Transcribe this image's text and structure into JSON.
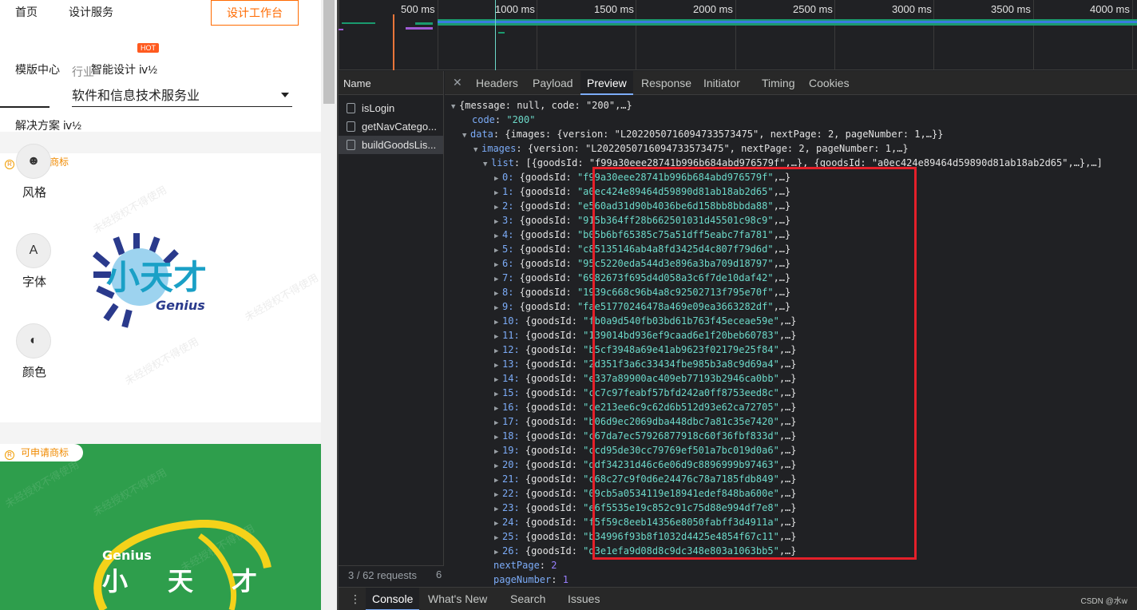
{
  "site": {
    "nav": {
      "home": "首页",
      "design_service": "设计服务",
      "workspace_button": "设计工作台"
    },
    "filters": {
      "template_center": "模版中心",
      "industry_label": "行业",
      "ai_design": "智能设计 ⅳ½",
      "hot": "HOT",
      "industry_value": "软件和信息技术服务业",
      "solutions": "解决方案 ⅳ½"
    },
    "badge": "可申请商标",
    "tools": [
      {
        "label": "风格",
        "glyph": "☻"
      },
      {
        "label": "字体",
        "glyph": "A"
      },
      {
        "label": "颜色",
        "glyph": "◐"
      }
    ],
    "logo1": {
      "cn": "小天才",
      "en": "Genius"
    },
    "logo2": {
      "en": "Genius",
      "chars": [
        "小",
        "天",
        "才"
      ]
    },
    "watermark": "未经授权不得使用"
  },
  "devtools": {
    "timeline_ticks": [
      "500 ms",
      "1000 ms",
      "1500 ms",
      "2000 ms",
      "2500 ms",
      "3000 ms",
      "3500 ms",
      "4000 ms"
    ],
    "name_header": "Name",
    "requests": [
      "isLogin",
      "getNavCatego...",
      "buildGoodsLis..."
    ],
    "request_count": "3 / 62 requests",
    "request_count_trail": "6",
    "tabs": [
      "Headers",
      "Payload",
      "Preview",
      "Response",
      "Initiator",
      "Timing",
      "Cookies"
    ],
    "active_tab": "Preview",
    "preview": {
      "root": "{message: null, code: \"200\",…}",
      "code_key": "code",
      "code_val": "\"200\"",
      "data_key": "data",
      "data_val": "{images: {version: \"L2022050716094733573475\", nextPage: 2, pageNumber: 1,…}}",
      "images_key": "images",
      "images_val": "{version: \"L2022050716094733573475\", nextPage: 2, pageNumber: 1,…}",
      "list_key": "list",
      "list_val": "[{goodsId: \"f99a30eee28741b996b684abd976579f\",…}, {goodsId: \"a0ec424e89464d59890d81ab18ab2d65\",…},…]",
      "items": [
        "f99a30eee28741b996b684abd976579f",
        "a0ec424e89464d59890d81ab18ab2d65",
        "e560ad31d90b4036be6d158bb8bbda88",
        "915b364ff28b662501031d45501c98c9",
        "b05b6bf65385c75a51dff5eabc7fa781",
        "c85135146ab4a8fd3425d4c807f79d6d",
        "95c5220eda544d3e896a3ba709d18797",
        "6982673f695d4d058a3c6f7de10daf42",
        "1939c668c96b4a8c92502713f795e70f",
        "fae51770246478a469e09ea3663282df",
        "fb0a9d540fb03bd61b763f45eceae59e",
        "139014bd936ef9caad6e1f20beb60783",
        "b5cf3948a69e41ab9623f02179e25f84",
        "2d351f3a6c33434fbe985b3a8c9d69a4",
        "e337a89900ac409eb77193b2946ca0bb",
        "cc7c97feabf57bfd242a0ff8753eed8c",
        "ce213ee6c9c62d6b512d93e62ca72705",
        "b06d9ec2069dba448dbc7a81c35e7420",
        "c67da7ec57926877918c60f36fbf833d",
        "ccd95de30cc79769ef501a7bc019d0a6",
        "ddf34231d46c6e06d9c8896999b97463",
        "c68c27c9f0d6e24476c78a7185fdb849",
        "09cb5a0534119e18941edef848ba600e",
        "e6f5535e19c852c91c75d88e994df7e8",
        "f5f59c8eeb14356e8050fabff3d4911a",
        "b34996f93b8f1032d4425e4854f67c11",
        "d3e1efa9d08d8c9dc348e803a1063bb5"
      ],
      "item_key": "goodsId",
      "next_page_key": "nextPage",
      "next_page_val": "2",
      "page_number_key": "pageNumber",
      "page_number_val": "1"
    },
    "console_tabs": [
      "Console",
      "What's New",
      "Search",
      "Issues"
    ],
    "console_active": "Console",
    "credit": "CSDN @水w"
  },
  "colors": {
    "accent_orange": "#ff6a00",
    "highlight_red": "#e4202a",
    "devtools_bg": "#202124",
    "card_green": "#2e9e4c"
  }
}
